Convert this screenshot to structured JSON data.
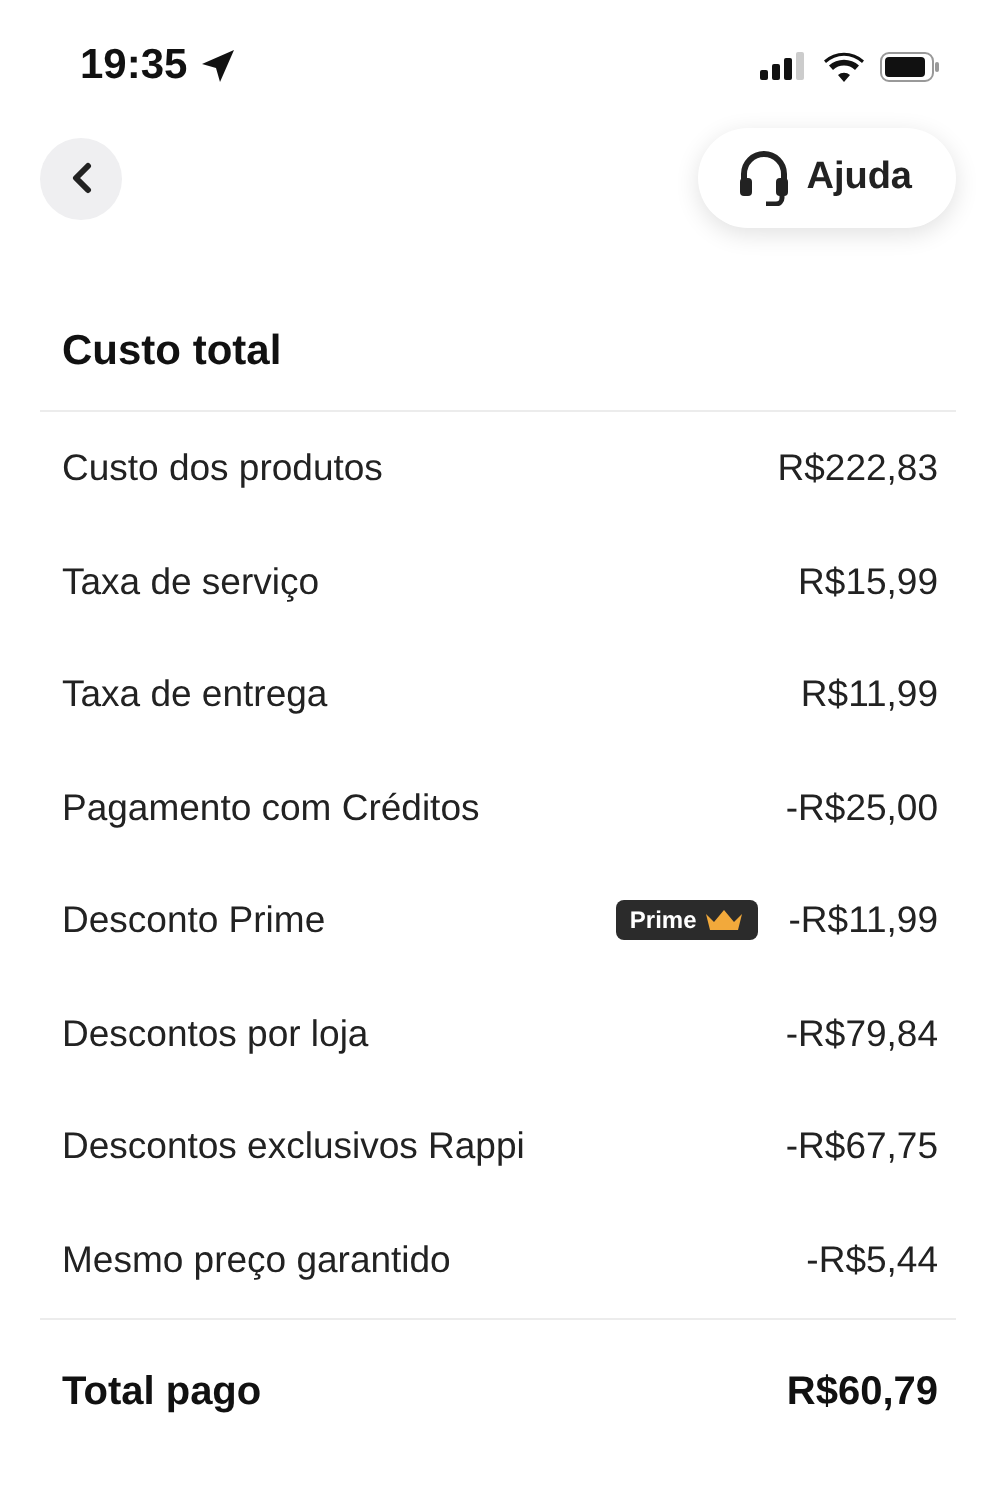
{
  "status_bar": {
    "time": "19:35"
  },
  "header": {
    "help_button": "Ajuda"
  },
  "title": "Custo total",
  "rows": [
    {
      "label": "Custo dos produtos",
      "value": "R$222,83"
    },
    {
      "label": "Taxa de serviço",
      "value": "R$15,99"
    },
    {
      "label": "Taxa de entrega",
      "value": "R$11,99"
    },
    {
      "label": "Pagamento com Créditos",
      "value": "-R$25,00"
    },
    {
      "label": "Desconto Prime",
      "value": "-R$11,99",
      "badge": "Prime"
    },
    {
      "label": "Descontos por loja",
      "value": "-R$79,84"
    },
    {
      "label": "Descontos exclusivos Rappi",
      "value": "-R$67,75"
    },
    {
      "label": "Mesmo preço garantido",
      "value": "-R$5,44"
    }
  ],
  "total": {
    "label": "Total pago",
    "value": "R$60,79"
  }
}
